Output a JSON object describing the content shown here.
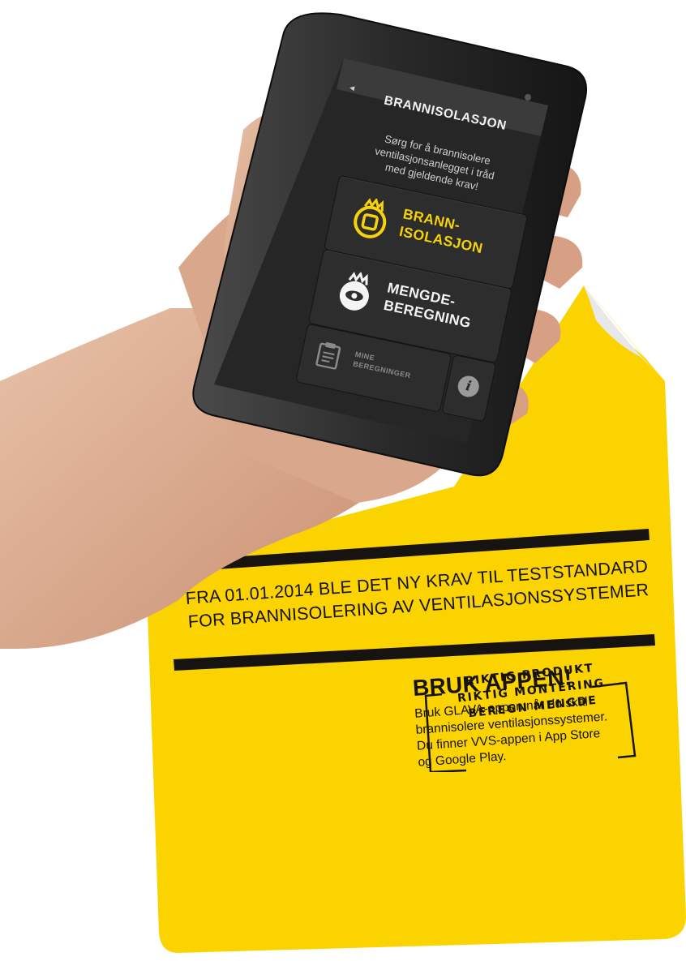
{
  "phone": {
    "back_glyph": "◄",
    "screen_title": "BRANNISOLASJON",
    "description_lines": [
      "Sørg for å brannisolere",
      "ventilasjonsanlegget i tråd",
      "med gjeldende krav!"
    ],
    "menu": [
      {
        "label_lines": [
          "BRANN-",
          "ISOLASJON"
        ],
        "icon": "fire-badge-icon",
        "color": "#f5d20a"
      },
      {
        "label_lines": [
          "MENGDE-",
          "BEREGNING"
        ],
        "icon": "fire-eye-icon",
        "color": "#f4f4f4"
      }
    ],
    "mine_label_lines": [
      "MINE",
      "BEREGNINGER"
    ],
    "mine_icon": "clipboard-icon",
    "info_glyph": "i"
  },
  "sticker": {
    "color": "#fbd300",
    "headline_lines": [
      "FRA 01.01.2014 BLE DET NY KRAV TIL TESTSTANDARD",
      "FOR BRANNISOLERING AV VENTILASJONSSYSTEMER"
    ],
    "cta_title": "BRUK APPEN!",
    "cta_body_lines": [
      "Bruk GLAVA-appen når du skal",
      "brannisolere ventilasjonssystemer.",
      "Du finner VVS-appen i App Store",
      "og Google Play."
    ],
    "stamp_lines": [
      "RIKTIG PRODUKT",
      "RIKTIG MONTERING",
      "BEREGN MENGDE"
    ]
  }
}
